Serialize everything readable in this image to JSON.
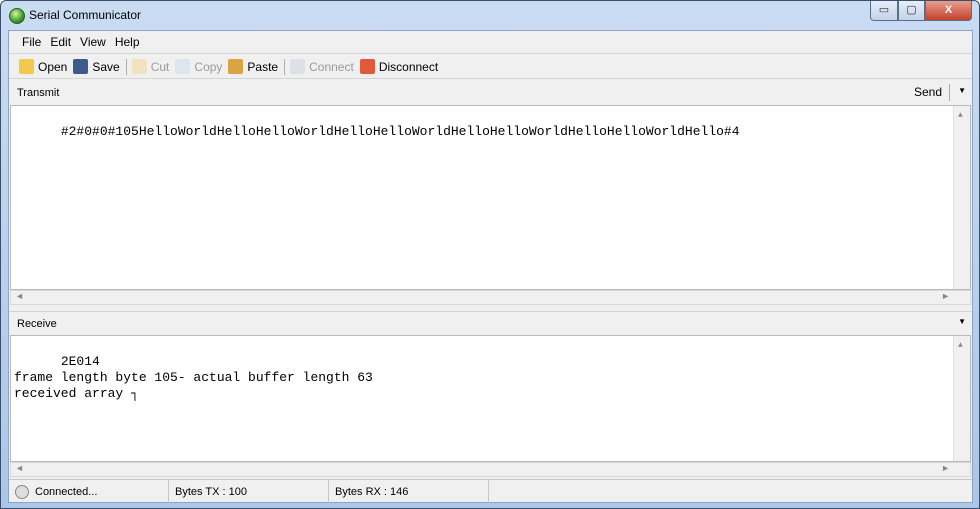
{
  "window": {
    "title": "Serial Communicator",
    "minimize": "▭",
    "maximize": "▢",
    "close": "X"
  },
  "menu": [
    "File",
    "Edit",
    "View",
    "Help"
  ],
  "toolbar": {
    "open": "Open",
    "save": "Save",
    "cut": "Cut",
    "copy": "Copy",
    "paste": "Paste",
    "connect": "Connect",
    "disconnect": "Disconnect"
  },
  "transmit": {
    "label": "Transmit",
    "send": "Send",
    "text": "#2#0#0#105HelloWorldHelloHelloWorldHelloHelloWorldHelloHelloWorldHelloHelloWorldHello#4"
  },
  "receive": {
    "label": "Receive",
    "text": "2E014\nframe length byte 105- actual buffer length 63\nreceived array ┐"
  },
  "status": {
    "connection": "Connected...",
    "bytes_tx": "Bytes TX : 100",
    "bytes_rx": "Bytes RX : 146"
  }
}
